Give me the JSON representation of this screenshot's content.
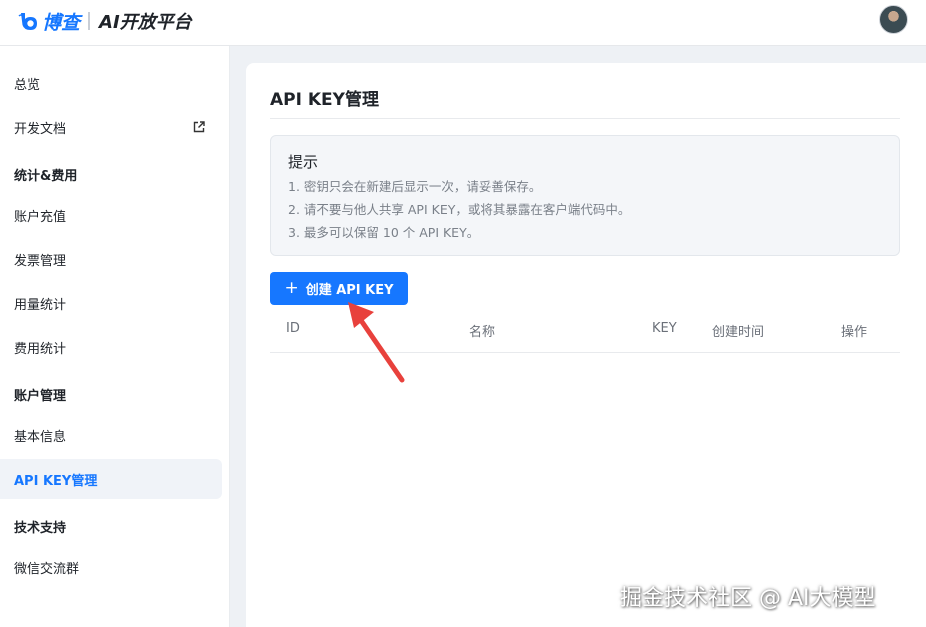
{
  "header": {
    "brand": "博查",
    "product": "AI开放平台"
  },
  "sidebar": {
    "items": [
      {
        "label": "总览"
      },
      {
        "label": "开发文档",
        "icon": "external-link-icon"
      },
      {
        "label": "统计&费用",
        "group": true
      },
      {
        "label": "账户充值"
      },
      {
        "label": "发票管理"
      },
      {
        "label": "用量统计"
      },
      {
        "label": "费用统计"
      },
      {
        "label": "账户管理",
        "group": true
      },
      {
        "label": "基本信息"
      },
      {
        "label": "API KEY管理",
        "active": true
      },
      {
        "label": "技术支持",
        "group": true
      },
      {
        "label": "微信交流群"
      }
    ]
  },
  "main": {
    "title": "API KEY管理",
    "tip": {
      "title": "提示",
      "lines": [
        "1. 密钥只会在新建后显示一次，请妥善保存。",
        "2. 请不要与他人共享 API KEY，或将其暴露在客户端代码中。",
        "3. 最多可以保留 10 个 API KEY。"
      ]
    },
    "create_button": "创建 API KEY",
    "table": {
      "columns": [
        "ID",
        "名称",
        "KEY",
        "创建时间",
        "操作"
      ]
    }
  },
  "watermark": "掘金技术社区 @ AI大模型",
  "colors": {
    "accent": "#1677ff",
    "arrow": "#e8413c",
    "background": "#eef1f5"
  }
}
